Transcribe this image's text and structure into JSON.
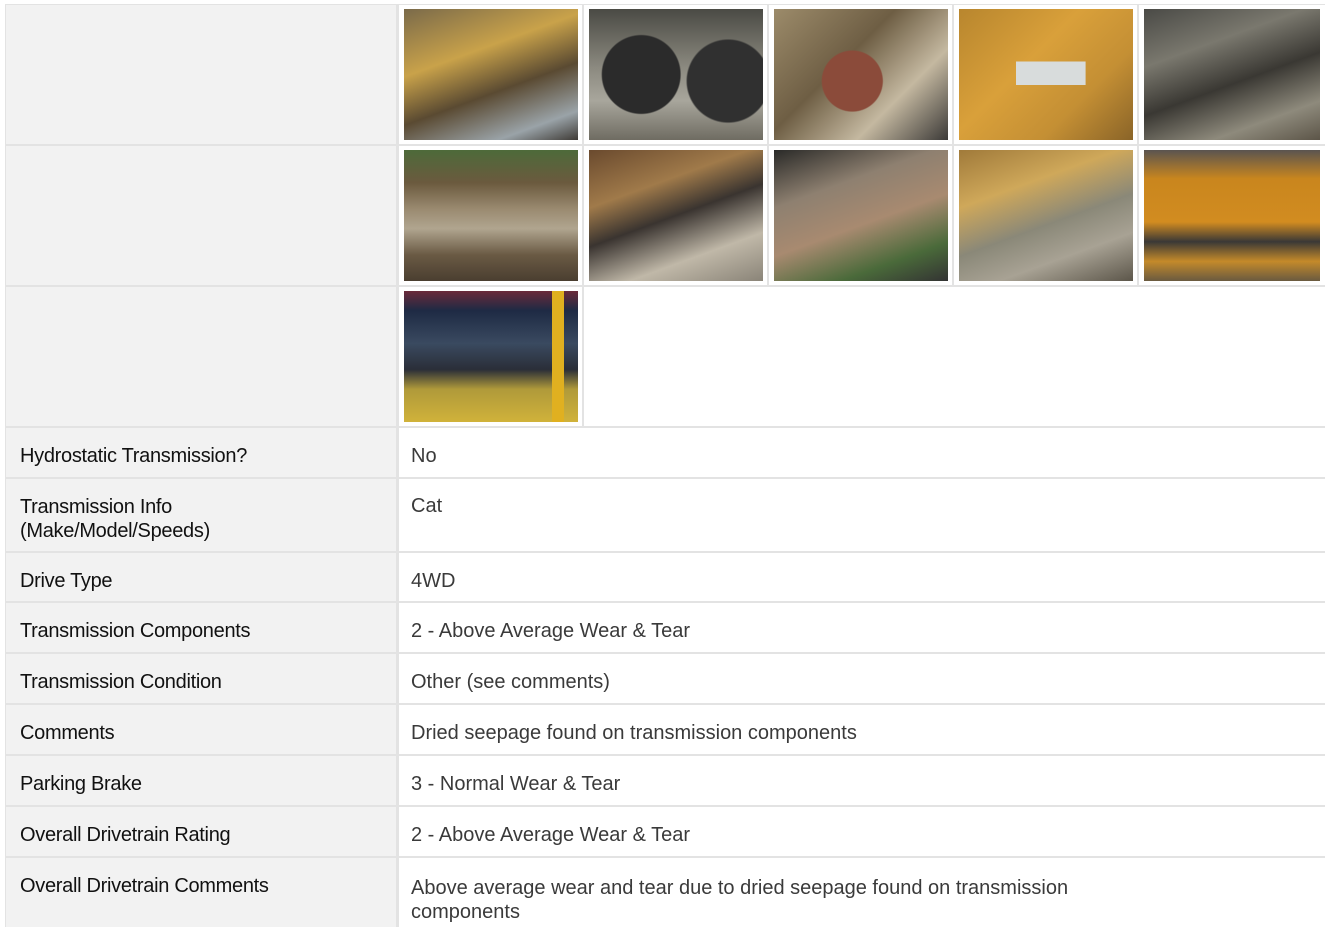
{
  "photo_rows": [
    {
      "label": "",
      "photos": [
        {
          "icon": "drivetrain-photo-1",
          "bg": "linear-gradient(160deg,#7a6a4a 0%,#c9a24a 35%,#5a4a32 60%,#9aa3a8 85%,#3f3b36 100%)"
        },
        {
          "icon": "drivetrain-photo-2",
          "bg": "radial-gradient(circle at 30% 50%,#2b2b2b 0 28%,transparent 29%),radial-gradient(circle at 80% 55%,#303030 0 26%,transparent 27%),linear-gradient(180deg,#4a4a44 0%,#8c8a80 45%,#a8a69c 70%,#6f6c62 100%)"
        },
        {
          "icon": "drivetrain-photo-3",
          "bg": "radial-gradient(circle at 45% 55%,#8b4b3a 0 25%,transparent 26%),linear-gradient(135deg,#9c8b6a 0%,#6e5e44 40%,#c4b8a0 70%,#3c3a38 100%)"
        },
        {
          "icon": "drivetrain-photo-4",
          "bg": "linear-gradient(180deg,transparent 40%,#d8dcdc 40% 58%,transparent 58%) 55% 0/40% 100% no-repeat,linear-gradient(135deg,#b8862e 0%,#d9a03a 40%,#c48f34 70%,#8a6428 100%)"
        },
        {
          "icon": "drivetrain-photo-5",
          "bg": "linear-gradient(160deg,#4a4a46 0%,#7a786e 30%,#3a3833 55%,#8e8a7c 80%,#5c5548 100%)"
        }
      ]
    },
    {
      "label": "",
      "photos": [
        {
          "icon": "drivetrain-photo-6",
          "bg": "linear-gradient(180deg,#4d6a3a 0%,#6b5a3e 25%,#9a8a70 45%,#b0a58f 60%,#6a5a44 80%,#4a3e30 100%)"
        },
        {
          "icon": "drivetrain-photo-7",
          "bg": "linear-gradient(160deg,#6a4a2e 0%,#a07a4a 30%,#3a3430 50%,#c0b8a8 75%,#8a8478 100%)"
        },
        {
          "icon": "drivetrain-photo-8",
          "bg": "linear-gradient(160deg,#2a2a28 0%,#8e8070 30%,#a88a70 55%,#4a6a3a 80%,#333 100%)"
        },
        {
          "icon": "drivetrain-photo-9",
          "bg": "linear-gradient(160deg,#a07a3a 0%,#cfa85a 30%,#8a8878 55%,#a8a294 75%,#5c564a 100%)"
        },
        {
          "icon": "drivetrain-photo-10",
          "bg": "linear-gradient(180deg,#5a5450 0%,#c9861e 22%,#d28c20 55%,#3a3836 70%,#c48a2a 85%,#6a5a40 100%)"
        }
      ]
    },
    {
      "label": "",
      "photos": [
        {
          "icon": "drivetrain-photo-11",
          "bg": "linear-gradient(90deg,transparent 85%,#e0b020 85% 92%,transparent 92%),linear-gradient(180deg,#6a2a3a 0%,#1e2a44 15%,#3a4a60 40%,#2a2e38 60%,#b09a3a 75%,#d0b23a 100%)"
        }
      ]
    }
  ],
  "fields": [
    {
      "label": "Hydrostatic Transmission?",
      "value": "No"
    },
    {
      "label": "Transmission Info\n(Make/Model/Speeds)",
      "value": "Cat"
    },
    {
      "label": "Drive Type",
      "value": "4WD"
    },
    {
      "label": "Transmission Components",
      "value": "2 - Above Average Wear & Tear"
    },
    {
      "label": "Transmission Condition",
      "value": "Other (see comments)"
    },
    {
      "label": "Comments",
      "value": "Dried seepage found on transmission components"
    },
    {
      "label": "Parking Brake",
      "value": "3 - Normal Wear & Tear"
    },
    {
      "label": "Overall Drivetrain Rating",
      "value": "2 - Above Average Wear & Tear"
    },
    {
      "label": "Overall Drivetrain Comments",
      "value": "Above average wear and tear due to dried seepage found on transmission\ncomponents"
    }
  ]
}
